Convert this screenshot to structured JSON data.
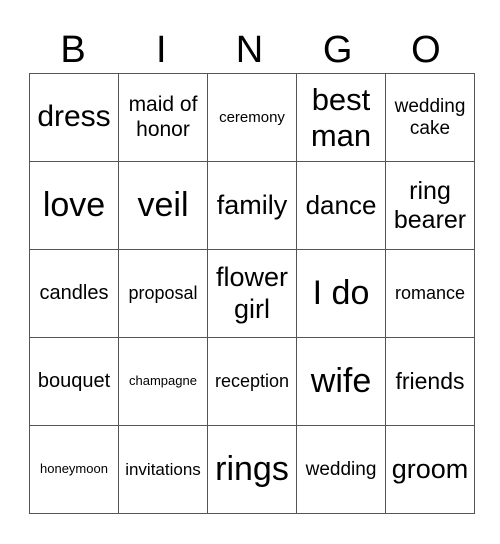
{
  "header": [
    "B",
    "I",
    "N",
    "G",
    "O"
  ],
  "cells": [
    [
      "dress",
      "maid of honor",
      "ceremony",
      "best man",
      "wedding cake"
    ],
    [
      "love",
      "veil",
      "family",
      "dance",
      "ring bearer"
    ],
    [
      "candles",
      "proposal",
      "flower girl",
      "I do",
      "romance"
    ],
    [
      "bouquet",
      "champagne",
      "reception",
      "wife",
      "friends"
    ],
    [
      "honeymoon",
      "invitations",
      "rings",
      "wedding",
      "groom"
    ]
  ]
}
